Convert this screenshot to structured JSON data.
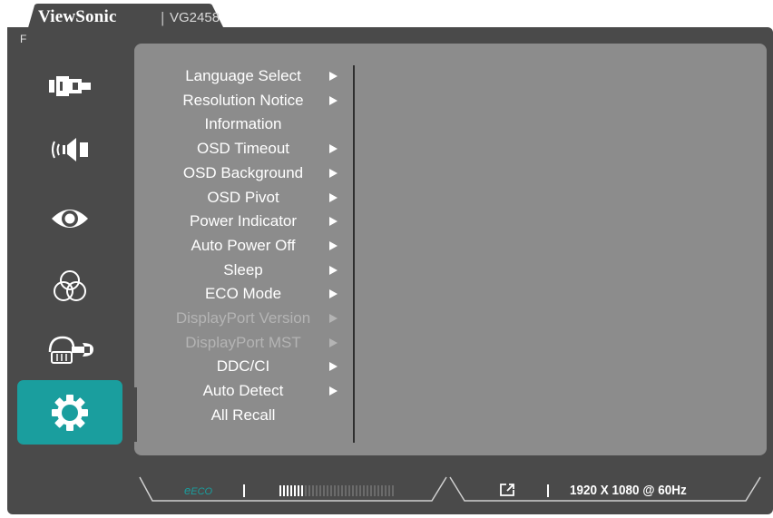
{
  "header": {
    "brand": "ViewSonic",
    "separator": "|",
    "model": "VG2458",
    "corner_letter": "F"
  },
  "nav": {
    "items": [
      {
        "name": "input-select",
        "icon": "input-plug-icon"
      },
      {
        "name": "audio-adjust",
        "icon": "speaker-icon"
      },
      {
        "name": "viewmode",
        "icon": "eye-icon"
      },
      {
        "name": "color-adjust",
        "icon": "color-circles-icon"
      },
      {
        "name": "manual-image-adjust",
        "icon": "hand-wrench-icon"
      },
      {
        "name": "setup-menu",
        "icon": "gear-icon",
        "active": true
      }
    ]
  },
  "menu": {
    "items": [
      {
        "label": "Language Select",
        "arrow": true,
        "enabled": true
      },
      {
        "label": "Resolution Notice",
        "arrow": true,
        "enabled": true
      },
      {
        "label": "Information",
        "arrow": false,
        "enabled": true
      },
      {
        "label": "OSD Timeout",
        "arrow": true,
        "enabled": true
      },
      {
        "label": "OSD Background",
        "arrow": true,
        "enabled": true
      },
      {
        "label": "OSD Pivot",
        "arrow": true,
        "enabled": true
      },
      {
        "label": "Power Indicator",
        "arrow": true,
        "enabled": true
      },
      {
        "label": "Auto Power Off",
        "arrow": true,
        "enabled": true
      },
      {
        "label": "Sleep",
        "arrow": true,
        "enabled": true
      },
      {
        "label": "ECO Mode",
        "arrow": true,
        "enabled": true
      },
      {
        "label": "DisplayPort Version",
        "arrow": true,
        "enabled": false
      },
      {
        "label": "DisplayPort MST",
        "arrow": true,
        "enabled": false
      },
      {
        "label": "DDC/CI",
        "arrow": true,
        "enabled": true
      },
      {
        "label": "Auto Detect",
        "arrow": true,
        "enabled": true
      },
      {
        "label": "All Recall",
        "arrow": false,
        "enabled": true
      }
    ]
  },
  "status": {
    "eco_prefix": "e",
    "eco_label": "ECO",
    "eco_level_fraction": 0.2,
    "input_icon": "input-source-icon",
    "resolution": "1920 X 1080 @ 60Hz"
  },
  "colors": {
    "accent": "#1a9e9e",
    "panel": "#8c8c8c",
    "frame": "#4a4a4a"
  }
}
